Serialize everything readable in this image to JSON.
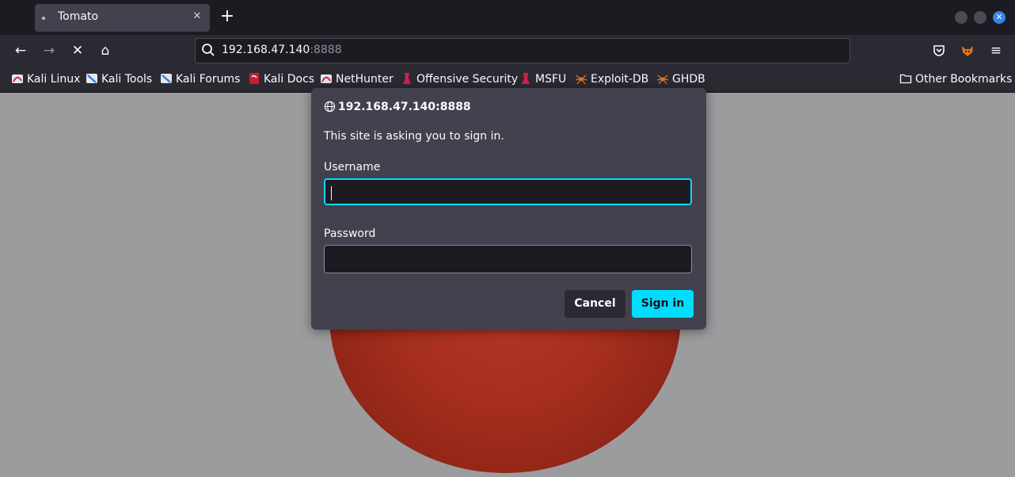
{
  "tab": {
    "title": "Tomato",
    "close_glyph": "✕"
  },
  "new_tab_glyph": "+",
  "window_controls": {
    "close_glyph": "✕"
  },
  "navigation": {
    "back_glyph": "←",
    "forward_glyph": "→",
    "stop_glyph": "✕",
    "home_glyph": "⌂",
    "menu_glyph": "≡"
  },
  "address_bar": {
    "host": "192.168.47.140",
    "port": ":8888"
  },
  "bookmarks": [
    {
      "label": "Kali Linux",
      "icon": "kali-dragon-icon"
    },
    {
      "label": "Kali Tools",
      "icon": "kali-tools-icon"
    },
    {
      "label": "Kali Forums",
      "icon": "kali-forums-icon"
    },
    {
      "label": "Kali Docs",
      "icon": "kali-docs-icon"
    },
    {
      "label": "NetHunter",
      "icon": "nethunter-icon"
    },
    {
      "label": "Offensive Security",
      "icon": "offsec-icon"
    },
    {
      "label": "MSFU",
      "icon": "msfu-icon"
    },
    {
      "label": "Exploit-DB",
      "icon": "exploitdb-spider-icon"
    },
    {
      "label": "GHDB",
      "icon": "ghdb-spider-icon"
    }
  ],
  "other_bookmarks": "Other Bookmarks",
  "auth_dialog": {
    "origin": "192.168.47.140:8888",
    "message": "This site is asking you to sign in.",
    "username_label": "Username",
    "username_value": "",
    "password_label": "Password",
    "password_value": "",
    "cancel_label": "Cancel",
    "signin_label": "Sign in"
  },
  "colors": {
    "accent": "#00ddff",
    "dialog_bg": "#42414d",
    "toolbar_bg": "#2b2a33",
    "frame_bg": "#1c1b22",
    "overlay_bg": "#9c9c9e",
    "tomato": "#a62e1d"
  }
}
